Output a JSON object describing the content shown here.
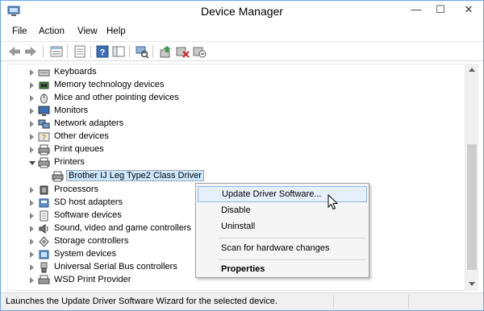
{
  "window": {
    "title": "Device Manager"
  },
  "title_buttons": {
    "minimize": "—",
    "maximize": "☐",
    "close": "✕"
  },
  "menu": [
    "File",
    "Action",
    "View",
    "Help"
  ],
  "toolbar": {
    "icons": [
      "back-icon",
      "forward-icon",
      "properties-icon",
      "show-hidden-icon",
      "help-icon",
      "console-view-icon",
      "scan-hardware-icon",
      "update-driver-icon",
      "uninstall-icon",
      "disable-icon"
    ]
  },
  "tree": {
    "items": [
      {
        "label": "Keyboards",
        "state": "collapsed",
        "icon": "keyboard-icon"
      },
      {
        "label": "Memory technology devices",
        "state": "collapsed",
        "icon": "memory-icon"
      },
      {
        "label": "Mice and other pointing devices",
        "state": "collapsed",
        "icon": "mouse-icon"
      },
      {
        "label": "Monitors",
        "state": "collapsed",
        "icon": "monitor-icon"
      },
      {
        "label": "Network adapters",
        "state": "collapsed",
        "icon": "network-icon"
      },
      {
        "label": "Other devices",
        "state": "collapsed",
        "icon": "other-devices-icon"
      },
      {
        "label": "Print queues",
        "state": "collapsed",
        "icon": "print-queue-icon"
      },
      {
        "label": "Printers",
        "state": "expanded",
        "icon": "printer-icon"
      },
      {
        "label": "Brother IJ Leg Type2 Class Driver",
        "state": "child-selected",
        "icon": "printer-icon"
      },
      {
        "label": "Processors",
        "state": "collapsed",
        "icon": "processor-icon"
      },
      {
        "label": "SD host adapters",
        "state": "collapsed",
        "icon": "sd-adapter-icon"
      },
      {
        "label": "Software devices",
        "state": "collapsed",
        "icon": "software-device-icon"
      },
      {
        "label": "Sound, video and game controllers",
        "state": "collapsed",
        "icon": "sound-icon"
      },
      {
        "label": "Storage controllers",
        "state": "collapsed",
        "icon": "storage-icon"
      },
      {
        "label": "System devices",
        "state": "collapsed",
        "icon": "system-icon"
      },
      {
        "label": "Universal Serial Bus controllers",
        "state": "collapsed",
        "icon": "usb-icon"
      },
      {
        "label": "WSD Print Provider",
        "state": "collapsed",
        "icon": "wsd-icon"
      }
    ]
  },
  "context_menu": {
    "items": [
      "Update Driver Software...",
      "Disable",
      "Uninstall",
      "Scan for hardware changes",
      "Properties"
    ],
    "highlighted": "Update Driver Software..."
  },
  "status": {
    "text": "Launches the Update Driver Software Wizard for the selected device."
  },
  "colors": {
    "accent": "#6aa8e8",
    "selection": "#cce8ff",
    "menu_highlight": "#e6f0fa"
  }
}
